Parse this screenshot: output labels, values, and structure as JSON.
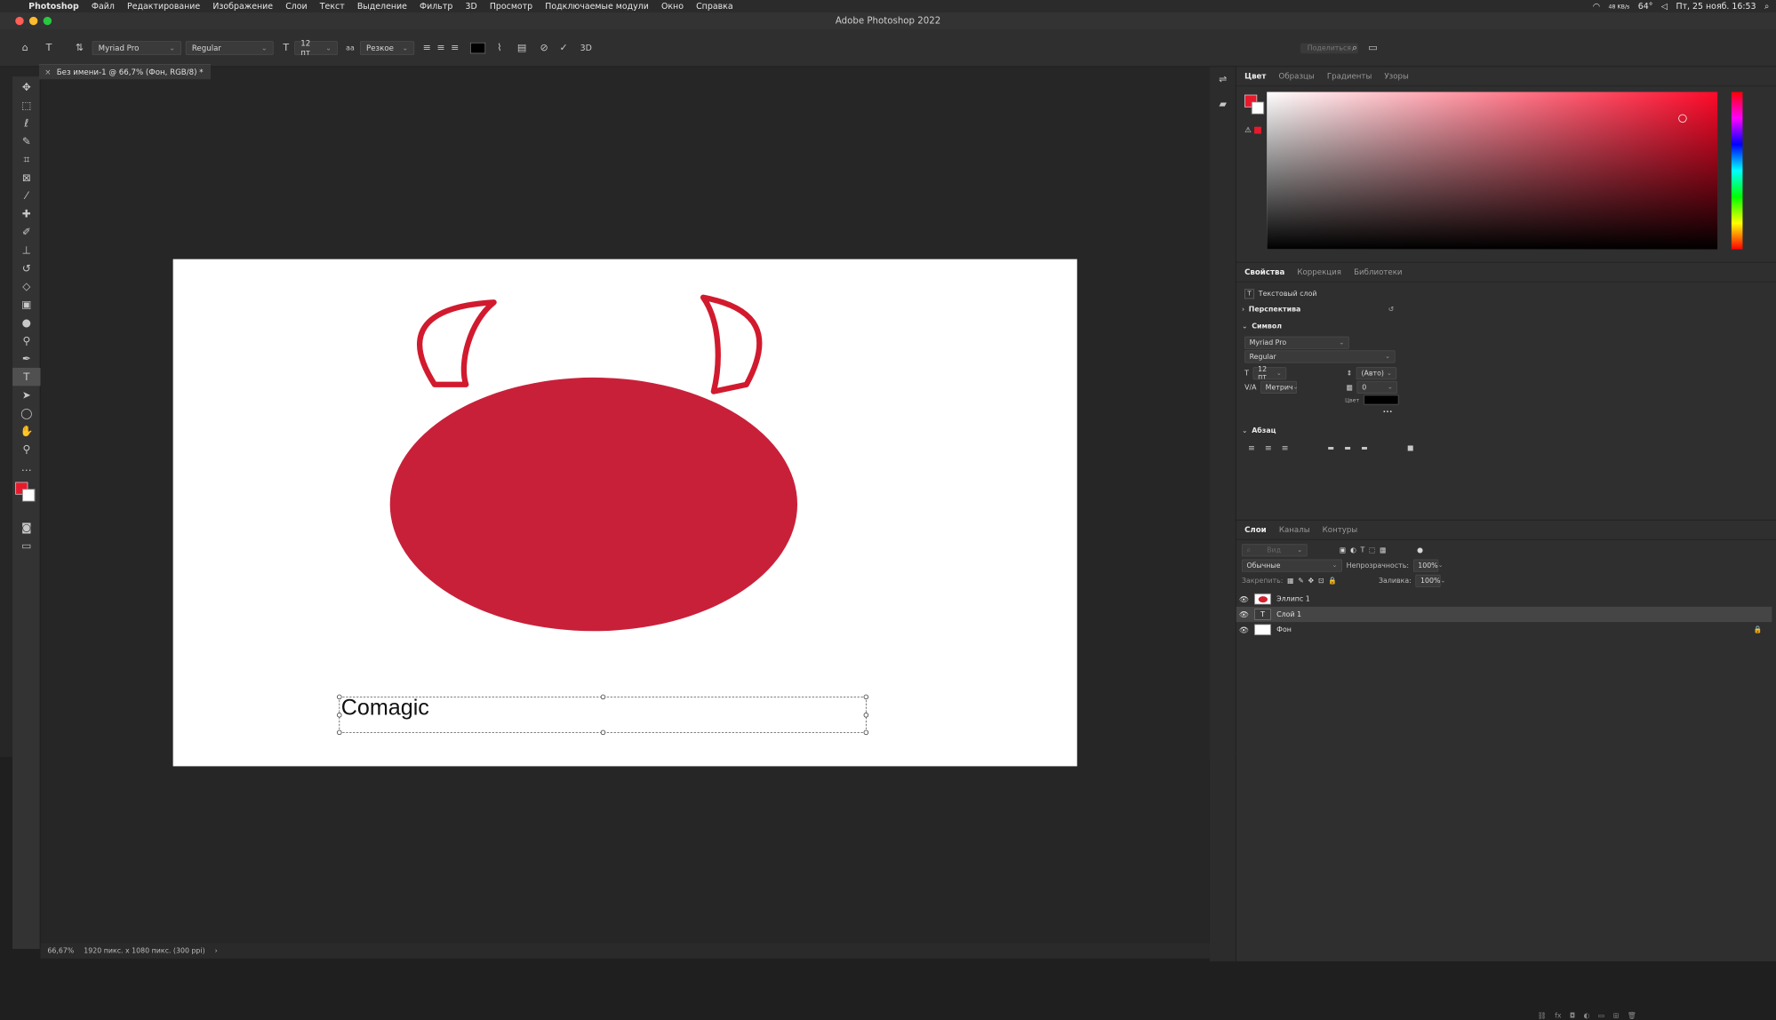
{
  "menubar": {
    "apple_icon": "apple-icon",
    "items": [
      "Photoshop",
      "Файл",
      "Редактирование",
      "Изображение",
      "Слои",
      "Текст",
      "Выделение",
      "Фильтр",
      "3D",
      "Просмотр",
      "Подключаемые модули",
      "Окно",
      "Справка"
    ],
    "net_speed": "48 KB/s",
    "temp": "64°",
    "datetime": "Пт, 25 нояб. 16:53"
  },
  "window": {
    "title": "Adobe Photoshop 2022"
  },
  "options": {
    "font_family": "Myriad Pro",
    "font_style": "Regular",
    "font_size": "12 пт",
    "aa_label": "aa",
    "antialias": "Резкое",
    "mode_3d": "3D",
    "share_label": "Поделиться"
  },
  "document": {
    "tab_title": "Без имени-1 @ 66,7% (Фон, RGB/8) *",
    "canvas_text": "Comagic"
  },
  "status": {
    "zoom": "66,67%",
    "info": "1920 пикс. x 1080 пикс. (300 ppi)",
    "arrow": "›"
  },
  "color_panel": {
    "tabs": [
      "Цвет",
      "Образцы",
      "Градиенты",
      "Узоры"
    ],
    "fg": "#e8192c",
    "bg": "#ffffff",
    "warn": "⚠"
  },
  "props_panel": {
    "tabs": [
      "Свойства",
      "Коррекция",
      "Библиотеки"
    ],
    "layer_type": "Текстовый слой",
    "perspective": "Перспектива",
    "symbol": "Символ",
    "font_family": "Myriad Pro",
    "font_style": "Regular",
    "size": "12 пт",
    "leading": "(Авто)",
    "kerning": "Метрич",
    "tracking": "0",
    "color_label": "Цвет",
    "more": "•••",
    "paragraph": "Абзац"
  },
  "layers_panel": {
    "tabs": [
      "Слои",
      "Каналы",
      "Контуры"
    ],
    "search_placeholder": "Вид",
    "blend_mode": "Обычные",
    "opacity_label": "Непрозрачность:",
    "opacity": "100%",
    "lock_label": "Закрепить:",
    "fill_label": "Заливка:",
    "fill": "100%",
    "layers": [
      {
        "name": "Эллипс 1",
        "kind": "ellipse"
      },
      {
        "name": "Слой 1",
        "kind": "text",
        "selected": true
      },
      {
        "name": "Фон",
        "kind": "background",
        "locked": true
      }
    ]
  }
}
